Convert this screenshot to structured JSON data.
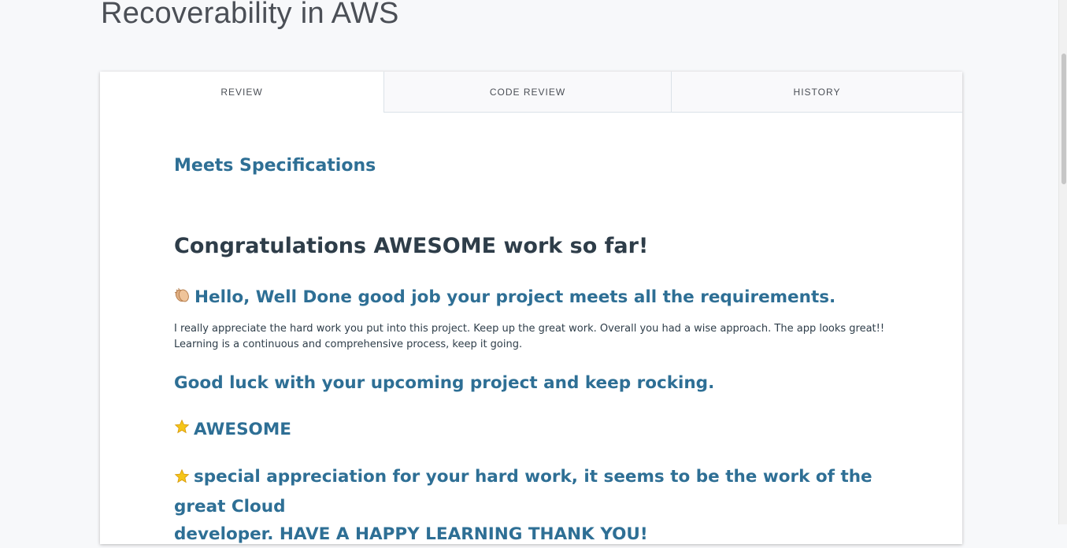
{
  "page": {
    "title": "Recoverability in AWS"
  },
  "tabs": [
    {
      "label": "REVIEW",
      "active": true
    },
    {
      "label": "CODE REVIEW",
      "active": false
    },
    {
      "label": "HISTORY",
      "active": false
    }
  ],
  "review": {
    "status": "Meets Specifications",
    "headline": "Congratulations AWESOME work so far!",
    "hello": "Hello, Well Done good job your project meets all the requirements.",
    "paragraph_line1": "I really appreciate the hard work you put into this project. Keep up the great work. Overall you had a wise approach. The app looks great!!",
    "paragraph_line2": "Learning is a continuous and comprehensive process, keep it going.",
    "good_luck": "Good luck with your upcoming project and keep rocking.",
    "awesome": "AWESOME",
    "special_line1": "special appreciation for your hard work, it seems to be the work of the great Cloud",
    "special_line2": "developer. HAVE A HAPPY LEARNING THANK YOU!"
  },
  "icons": {
    "clap": "clapping-hands-icon",
    "star": "star-icon"
  },
  "colors": {
    "accent_blue": "#2e6f95",
    "heading_dark": "#2e3d49",
    "background": "#f7f8fa"
  }
}
